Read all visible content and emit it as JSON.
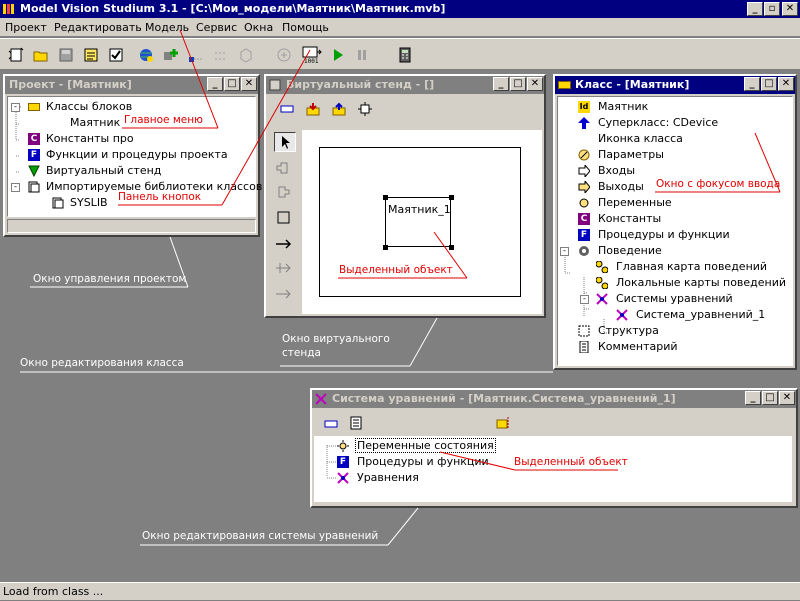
{
  "app": {
    "title": "Model Vision Studium 3.1 - [C:\\Мои_модели\\Маятник\\Маятник.mvb]"
  },
  "menu": [
    "Проект",
    "Редактировать",
    "Модель",
    "Сервис",
    "Окна",
    "Помощь"
  ],
  "toolbar_icons": [
    "new-icon",
    "open-icon",
    "save-icon",
    "checklist-icon",
    "check-icon",
    "globe-icon",
    "add-icon",
    "link-icon",
    "align-icon",
    "cube-icon",
    "grid-icon",
    "run-settings-icon",
    "play-icon",
    "pause-icon",
    "calculator-icon"
  ],
  "project_window": {
    "title": "Проект - [Маятник]",
    "items": [
      "Классы блоков",
      "Маятник",
      "Константы про",
      "Функции и процедуры проекта",
      "Виртуальный стенд",
      "Импортируемые библиотеки классов",
      "SYSLIB"
    ]
  },
  "stand_window": {
    "title": "Виртуальный стенд - []",
    "object_label": "Маятник_1"
  },
  "class_window": {
    "title": "Класс - [Маятник]",
    "items": [
      "Маятник",
      "Суперкласс: CDevice",
      "Иконка класса",
      "Параметры",
      "Входы",
      "Выходы",
      "Переменные",
      "Константы",
      "Процедуры и функции",
      "Поведение",
      "Главная карта поведений",
      "Локальные карты поведений",
      "Системы уравнений",
      "Система_уравнений_1",
      "Структура",
      "Комментарий"
    ]
  },
  "eq_window": {
    "title": "Система уравнений - [Маятник.Система_уравнений_1]",
    "items": [
      "Переменные состояния",
      "Процедуры и функции",
      "Уравнения"
    ]
  },
  "annotations": {
    "main_menu": "Главное меню",
    "toolbar_panel": "Панель кнопок",
    "focus_window": "Окно с фокусом ввода",
    "selected_object": "Выделенный объект",
    "selected_object2": "Выделенный объект",
    "project_control": "Окно управления проектом",
    "virtual_stand": "Окно виртуального стенда",
    "class_edit": "Окно редактирования класса",
    "eq_edit": "Окно редактирования системы уравнений"
  },
  "status": {
    "text": "Load from class ..."
  }
}
